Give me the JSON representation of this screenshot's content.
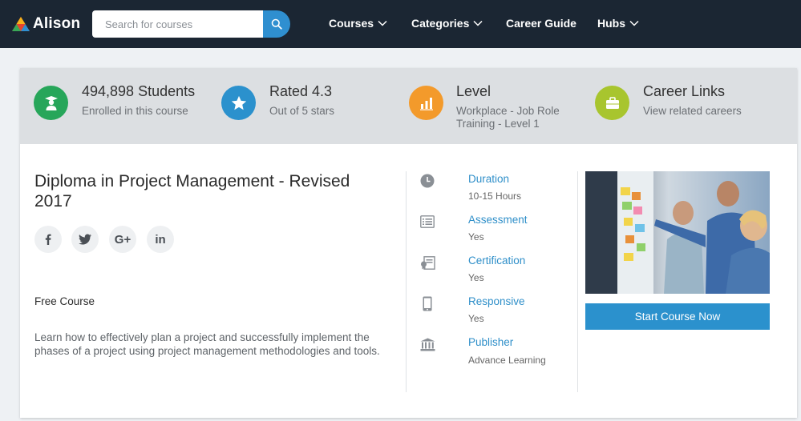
{
  "header": {
    "logo_text": "Alison",
    "search_placeholder": "Search for courses",
    "nav": [
      {
        "label": "Courses",
        "has_dropdown": true
      },
      {
        "label": "Categories",
        "has_dropdown": true
      },
      {
        "label": "Career Guide",
        "has_dropdown": false
      },
      {
        "label": "Hubs",
        "has_dropdown": true
      }
    ]
  },
  "stats": [
    {
      "title": "494,898 Students",
      "subtitle": "Enrolled in this course",
      "icon": "graduate-icon",
      "color": "#27a65a"
    },
    {
      "title": "Rated 4.3",
      "subtitle": "Out of 5 stars",
      "icon": "star-icon",
      "color": "#2b91cd"
    },
    {
      "title": "Level",
      "subtitle_lines": [
        "Workplace - Job Role",
        "Training - Level 1"
      ],
      "icon": "bar-chart-icon",
      "color": "#f39a2b"
    },
    {
      "title": "Career Links",
      "subtitle": "View related careers",
      "icon": "briefcase-icon",
      "color": "#a8c52e"
    }
  ],
  "course": {
    "title": "Diploma in Project Management - Revised 2017",
    "social": [
      "facebook-icon",
      "twitter-icon",
      "google-plus-icon",
      "linkedin-icon"
    ],
    "social_glyphs": [
      "f",
      "t",
      "G+",
      "in"
    ],
    "price_label": "Free Course",
    "description": "Learn how to effectively plan a project and successfully implement the phases of a project using project management methodologies and tools."
  },
  "details": [
    {
      "label": "Duration",
      "value": "10-15 Hours",
      "icon": "clock-icon"
    },
    {
      "label": "Assessment",
      "value": "Yes",
      "icon": "list-icon"
    },
    {
      "label": "Certification",
      "value": "Yes",
      "icon": "certificate-icon"
    },
    {
      "label": "Responsive",
      "value": "Yes",
      "icon": "mobile-icon"
    },
    {
      "label": "Publisher",
      "value": "Advance Learning",
      "icon": "institution-icon"
    }
  ],
  "cta": {
    "label": "Start Course Now"
  },
  "colors": {
    "header_bg": "#1b2633",
    "accent": "#2b91cd",
    "stats_bg": "#dcdfe2"
  }
}
